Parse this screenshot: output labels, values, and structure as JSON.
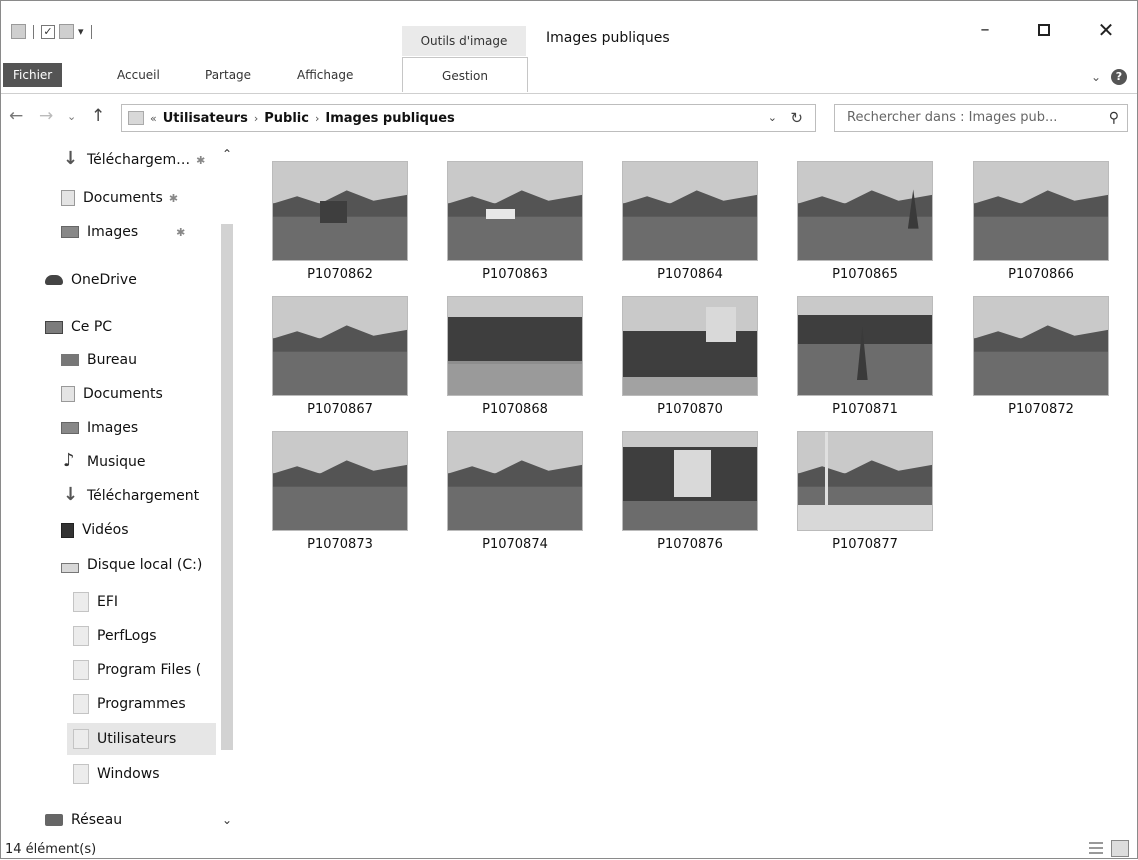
{
  "titlebar": {
    "contextual_tab": "Outils d'image",
    "title": "Images publiques",
    "minimize": "–",
    "close": "✕"
  },
  "ribbon": {
    "tabs": [
      "Fichier",
      "Accueil",
      "Partage",
      "Affichage",
      "Gestion"
    ],
    "collapse": "⌄",
    "help": "?"
  },
  "address": {
    "overflow": "«",
    "crumbs": [
      "Utilisateurs",
      "Public",
      "Images publiques"
    ],
    "separator": "›",
    "dropdown": "⌄",
    "refresh": "↻"
  },
  "search": {
    "placeholder": "Rechercher dans : Images pub...",
    "icon": "search-icon"
  },
  "sidebar": {
    "items": [
      {
        "label": "Téléchargem…",
        "icon": "download-icon",
        "pinned": true
      },
      {
        "label": "Documents",
        "icon": "document-icon",
        "pinned": true
      },
      {
        "label": "Images",
        "icon": "pictures-icon",
        "pinned": true
      },
      {
        "label": "OneDrive",
        "icon": "cloud-icon"
      },
      {
        "label": "Ce PC",
        "icon": "computer-icon"
      },
      {
        "label": "Bureau",
        "icon": "desktop-icon"
      },
      {
        "label": "Documents",
        "icon": "document-icon"
      },
      {
        "label": "Images",
        "icon": "pictures-icon"
      },
      {
        "label": "Musique",
        "icon": "music-icon"
      },
      {
        "label": "Téléchargement",
        "icon": "download-icon"
      },
      {
        "label": "Vidéos",
        "icon": "video-icon"
      },
      {
        "label": "Disque local (C:)",
        "icon": "drive-icon"
      },
      {
        "label": "EFI",
        "icon": "folder-icon"
      },
      {
        "label": "PerfLogs",
        "icon": "folder-icon"
      },
      {
        "label": "Program Files (",
        "icon": "folder-icon"
      },
      {
        "label": "Programmes",
        "icon": "folder-icon"
      },
      {
        "label": "Utilisateurs",
        "icon": "folder-icon",
        "selected": true
      },
      {
        "label": "Windows",
        "icon": "folder-icon"
      },
      {
        "label": "Réseau",
        "icon": "network-icon"
      }
    ],
    "pin_glyph": "✱"
  },
  "files": [
    {
      "name": "P1070862",
      "scene": "lake-island"
    },
    {
      "name": "P1070863",
      "scene": "lake-boat"
    },
    {
      "name": "P1070864",
      "scene": "lake-mountains"
    },
    {
      "name": "P1070865",
      "scene": "lake-sail"
    },
    {
      "name": "P1070866",
      "scene": "lake-mountains"
    },
    {
      "name": "P1070867",
      "scene": "lake-mountains"
    },
    {
      "name": "P1070868",
      "scene": "hills-shore"
    },
    {
      "name": "P1070870",
      "scene": "castle-trees"
    },
    {
      "name": "P1070871",
      "scene": "lake-sail"
    },
    {
      "name": "P1070872",
      "scene": "lake-mountains"
    },
    {
      "name": "P1070873",
      "scene": "lake-mountains"
    },
    {
      "name": "P1070874",
      "scene": "lake-mountains"
    },
    {
      "name": "P1070876",
      "scene": "castle-trees"
    },
    {
      "name": "P1070877",
      "scene": "boat-mast"
    }
  ],
  "status": {
    "count": "14 élément(s)"
  }
}
